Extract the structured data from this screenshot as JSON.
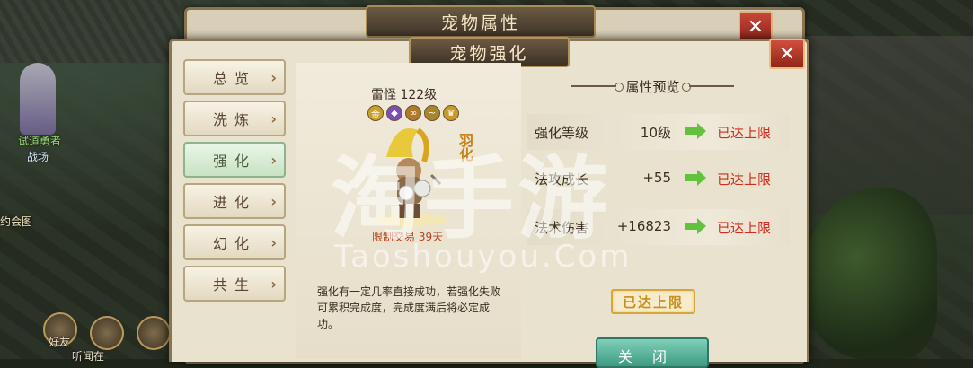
{
  "world": {
    "npc_name": "试道勇者",
    "npc_title": "战场",
    "npc_left": "约会图",
    "hud_friend": "好友",
    "hud_listen": "听闻在"
  },
  "back_panel": {
    "title": "宠物属性",
    "close_glyph": "✕"
  },
  "panel": {
    "title": "宠物强化",
    "close_glyph": "✕"
  },
  "tabs": [
    {
      "label": "总览",
      "active": false
    },
    {
      "label": "洗炼",
      "active": false
    },
    {
      "label": "强化",
      "active": true
    },
    {
      "label": "进化",
      "active": false
    },
    {
      "label": "幻化",
      "active": false
    },
    {
      "label": "共生",
      "active": false
    }
  ],
  "tab_arrow": "›",
  "pet": {
    "name": "雷怪 122级",
    "evolve_tag": "羽化",
    "trade_limit": "限制交易 39天",
    "icons": [
      {
        "glyph": "金",
        "color": "#c8a12a"
      },
      {
        "glyph": "◆",
        "color": "#7b4fb5"
      },
      {
        "glyph": "∞",
        "color": "#b07a2a"
      },
      {
        "glyph": "~",
        "color": "#a7862c"
      },
      {
        "glyph": "♛",
        "color": "#c99a28"
      }
    ]
  },
  "description": "强化有一定几率直接成功，若强化失败可累积完成度，完成度满后将必定成功。",
  "preview": {
    "heading": "属性预览",
    "rows": [
      {
        "label": "强化等级",
        "value": "10级",
        "status": "已达上限"
      },
      {
        "label": "法攻成长",
        "value": "+55",
        "status": "已达上限"
      },
      {
        "label": "法术伤害",
        "value": "+16823",
        "status": "已达上限"
      }
    ],
    "max_stamp": "已达上限",
    "close_label": "关闭"
  },
  "watermark": {
    "big": "淘手游",
    "small": "Taoshouyou.Com"
  }
}
